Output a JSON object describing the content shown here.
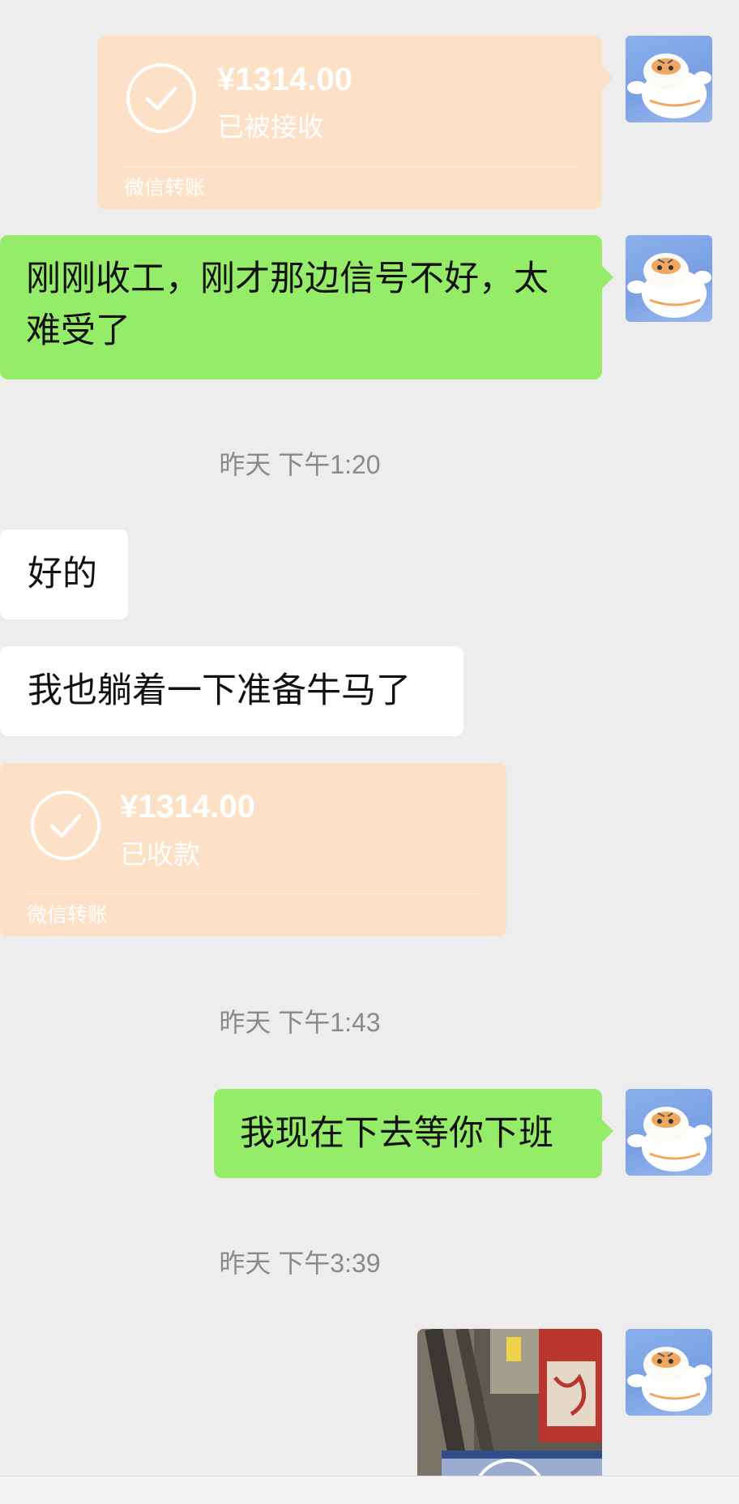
{
  "transfer_sent": {
    "amount": "¥1314.00",
    "status": "已被接收",
    "brand": "微信转账"
  },
  "msg_signal": {
    "line1": "刚刚收工，刚才那边信号不好，太",
    "line2": "难受了"
  },
  "timestamp_1": "昨天 下午1:20",
  "msg_ok": "好的",
  "msg_rest": "我也躺着一下准备牛马了",
  "transfer_received": {
    "amount": "¥1314.00",
    "status": "已收款",
    "brand": "微信转账"
  },
  "timestamp_2": "昨天 下午1:43",
  "msg_wait": "我现在下去等你下班",
  "timestamp_3": "昨天 下午3:39",
  "icons": {
    "avatar": "tiger-cartoon-avatar",
    "check": "check-circle-icon",
    "photo": "video-thumbnail"
  },
  "colors": {
    "background": "#ededed",
    "bubble_self": "#95ec69",
    "bubble_other": "#ffffff",
    "transfer_card": "#fde1c6",
    "timestamp_text": "#8a8a8a"
  }
}
